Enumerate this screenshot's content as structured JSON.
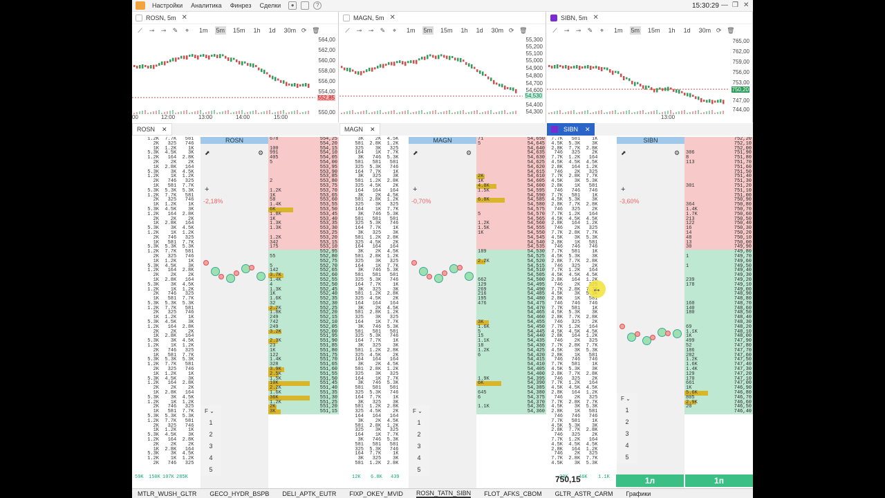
{
  "menu": {
    "items": [
      "Настройки",
      "Аналитика",
      "Финрез",
      "Сделки"
    ],
    "clock": "15:30:29"
  },
  "charts": [
    {
      "tab": "ROSN, 5m",
      "timeframes": [
        "1m",
        "5m",
        "15m",
        "1h",
        "1d",
        "30m"
      ],
      "selected": "5m",
      "prices": [
        "564,00",
        "562,00",
        "560,00",
        "558,00",
        "556,00",
        "554,00",
        "552,85",
        "550,00"
      ],
      "current_price": "552,85",
      "times": [
        "00",
        "12:00",
        "13:00",
        "14:00",
        "15:00"
      ]
    },
    {
      "tab": "MAGN, 5m",
      "timeframes": [
        "1m",
        "5m",
        "15m",
        "1h",
        "1d",
        "30m"
      ],
      "selected": "5m",
      "prices": [
        "55,300",
        "55,200",
        "55,100",
        "55,000",
        "54,900",
        "54,800",
        "54,700",
        "54,600",
        "54,530",
        "54,400",
        "54,300"
      ],
      "current_price": "54,530",
      "times": []
    },
    {
      "tab": "SIBN, 5m",
      "timeframes": [
        "1m",
        "5m",
        "15m",
        "1h",
        "1d",
        "30m"
      ],
      "selected": "5m",
      "prices": [
        "765,00",
        "762,00",
        "759,00",
        "756,00",
        "753,00",
        "750,20",
        "747,00",
        "744,00"
      ],
      "current_price": "750,20",
      "times": [
        "13:00"
      ]
    }
  ],
  "doms": [
    {
      "tab": "ROSN",
      "header": "ROSN",
      "pct": "-2,18%",
      "book": [
        [
          "678",
          "554,25"
        ],
        [
          "",
          "554,20"
        ],
        [
          "100",
          "554,15"
        ],
        [
          "991",
          "554,10"
        ],
        [
          "405",
          "554,05"
        ],
        [
          "5",
          "554,00"
        ],
        [
          "",
          "553,95"
        ],
        [
          "",
          "553,90"
        ],
        [
          "",
          "553,85"
        ],
        [
          "2",
          "553,80"
        ],
        [
          "",
          "553,75"
        ],
        [
          "1.2K",
          "553,70"
        ],
        [
          "1K",
          "553,65"
        ],
        [
          "58",
          "553,60"
        ],
        [
          "1.4K",
          "553,55"
        ],
        [
          "6K",
          "553,50"
        ],
        [
          "1.8K",
          "553,45"
        ],
        [
          "1K",
          "553,40"
        ],
        [
          "1.3K",
          "553,35"
        ],
        [
          "1.3K",
          "553,30"
        ],
        [
          "",
          "553,25"
        ],
        [
          "1.2K",
          "553,20"
        ],
        [
          "342",
          "553,15"
        ],
        [
          "175",
          "553,10"
        ],
        [
          "",
          "552,95"
        ],
        [
          "55",
          "552,80"
        ],
        [
          "",
          "552,75"
        ],
        [
          "5",
          "552,70"
        ],
        [
          "142",
          "552,65"
        ],
        [
          "3.7K",
          "552,60"
        ],
        [
          "1.4K",
          "552,55"
        ],
        [
          "4",
          "552,50"
        ],
        [
          "1.3K",
          "552,45"
        ],
        [
          "1K",
          "552,40"
        ],
        [
          "1.6K",
          "552,35"
        ],
        [
          "32",
          "552,30"
        ],
        [
          "2.2K",
          "552,25"
        ],
        [
          "1.8K",
          "552,20"
        ],
        [
          "249",
          "552,15"
        ],
        [
          "742",
          "552,10"
        ],
        [
          "249",
          "552,05"
        ],
        [
          "3.2K",
          "552,00"
        ],
        [
          "",
          "551,95"
        ],
        [
          "2.3K",
          "551,90"
        ],
        [
          "23",
          "551,85"
        ],
        [
          "1K",
          "551,80"
        ],
        [
          "122",
          "551,75"
        ],
        [
          "1.4K",
          "551,70"
        ],
        [
          "328",
          "551,65"
        ],
        [
          "3.9K",
          "551,60"
        ],
        [
          "2.5K",
          "551,55"
        ],
        [
          "1.5K",
          "551,50"
        ],
        [
          "10K",
          "551,45"
        ],
        [
          "2.2K",
          "551,40"
        ],
        [
          "1.6K",
          "551,35"
        ],
        [
          "36K",
          "551,30"
        ],
        [
          "1.2K",
          "551,25"
        ],
        [
          "2K",
          "551,20"
        ],
        [
          "3K",
          "551,15"
        ]
      ],
      "levels": [
        "1",
        "2",
        "3",
        "4",
        "5"
      ],
      "stats": [
        "59K",
        "150K",
        "107K",
        "285K"
      ]
    },
    {
      "tab": "MAGN",
      "header": "MAGN",
      "pct": "-0,70%",
      "book": [
        [
          "71",
          "54,650"
        ],
        [
          "5",
          "54,645"
        ],
        [
          "",
          "54,640"
        ],
        [
          "",
          "54,635"
        ],
        [
          "",
          "54,630"
        ],
        [
          "",
          "54,625"
        ],
        [
          "",
          "54,620"
        ],
        [
          "",
          "54,615"
        ],
        [
          "2K",
          "54,610"
        ],
        [
          "1K",
          "54,605"
        ],
        [
          "4.8K",
          "54,600"
        ],
        [
          "1.5K",
          "54,595"
        ],
        [
          "",
          "54,590"
        ],
        [
          "6.8K",
          "54,585"
        ],
        [
          "",
          "54,580"
        ],
        [
          "",
          "54,575"
        ],
        [
          "5",
          "54,570"
        ],
        [
          "",
          "54,565"
        ],
        [
          "1.2K",
          "54,560"
        ],
        [
          "1.5K",
          "54,555"
        ],
        [
          "1K",
          "54,550"
        ],
        [
          "",
          "54,545"
        ],
        [
          "",
          "54,540"
        ],
        [
          "",
          "54,535"
        ],
        [
          "189",
          "54,530"
        ],
        [
          "",
          "54,525"
        ],
        [
          "2.2K",
          "54,520"
        ],
        [
          "",
          "54,515"
        ],
        [
          "",
          "54,510"
        ],
        [
          "",
          "54,505"
        ],
        [
          "662",
          "54,500"
        ],
        [
          "129",
          "54,495"
        ],
        [
          "269",
          "54,490"
        ],
        [
          "216",
          "54,485"
        ],
        [
          "195",
          "54,480"
        ],
        [
          "476",
          "54,475"
        ],
        [
          "",
          "54,470"
        ],
        [
          "",
          "54,465"
        ],
        [
          "",
          "54,460"
        ],
        [
          "3K",
          "54,455"
        ],
        [
          "1.6K",
          "54,450"
        ],
        [
          "5",
          "54,445"
        ],
        [
          "15",
          "54,440"
        ],
        [
          "1.1K",
          "54,435"
        ],
        [
          "18",
          "54,430"
        ],
        [
          "1.2K",
          "54,425"
        ],
        [
          "6",
          "54,420"
        ],
        [
          "",
          "54,415"
        ],
        [
          "",
          "54,410"
        ],
        [
          "",
          "54,405"
        ],
        [
          "",
          "54,400"
        ],
        [
          "1.9K",
          "54,395"
        ],
        [
          "6K",
          "54,390"
        ],
        [
          "",
          "54,385"
        ],
        [
          "645",
          "54,380"
        ],
        [
          "6",
          "54,375"
        ],
        [
          "",
          "54,370"
        ],
        [
          "1.1K",
          "54,365"
        ],
        [
          "",
          "54,360"
        ]
      ],
      "levels": [
        "1",
        "2",
        "3",
        "4",
        "5"
      ],
      "stats": [
        "12K",
        "6.8K",
        "439",
        ""
      ]
    },
    {
      "tab": "SIBN",
      "header": "SIBN",
      "pct": "-3,60%",
      "book": [
        [
          "",
          "752,20"
        ],
        [
          "",
          "752,10"
        ],
        [
          "",
          "752,00"
        ],
        [
          "306",
          "751,90"
        ],
        [
          "8",
          "751,80"
        ],
        [
          "113",
          "751,70"
        ],
        [
          "",
          "751,60"
        ],
        [
          "",
          "751,50"
        ],
        [
          "",
          "751,40"
        ],
        [
          "",
          "751,30"
        ],
        [
          "301",
          "751,20"
        ],
        [
          "",
          "751,10"
        ],
        [
          "",
          "751,00"
        ],
        [
          "",
          "750,90"
        ],
        [
          "364",
          "750,80"
        ],
        [
          "1.4K",
          "750,70"
        ],
        [
          "1.7K",
          "750,60"
        ],
        [
          "213",
          "750,50"
        ],
        [
          "122",
          "750,40"
        ],
        [
          "16",
          "750,30"
        ],
        [
          "14",
          "750,20"
        ],
        [
          "48",
          "750,10"
        ],
        [
          "13",
          "750,00"
        ],
        [
          "30",
          "749,90"
        ],
        [
          "",
          "749,80"
        ],
        [
          "1",
          "749,70"
        ],
        [
          "",
          "749,60"
        ],
        [
          "1",
          "749,50"
        ],
        [
          "",
          "749,40"
        ],
        [
          "",
          "749,30"
        ],
        [
          "239",
          "749,20"
        ],
        [
          "178",
          "749,10"
        ],
        [
          "",
          "749,00"
        ],
        [
          "",
          "748,90"
        ],
        [
          "",
          "748,80"
        ],
        [
          "160",
          "748,70"
        ],
        [
          "140",
          "748,60"
        ],
        [
          "180",
          "748,50"
        ],
        [
          "",
          "748,40"
        ],
        [
          "",
          "748,30"
        ],
        [
          "69",
          "748,20"
        ],
        [
          "1.1K",
          "748,10"
        ],
        [
          "1K",
          "748,00"
        ],
        [
          "499",
          "747,90"
        ],
        [
          "52",
          "747,80"
        ],
        [
          "186",
          "747,70"
        ],
        [
          "282",
          "747,60"
        ],
        [
          "1.2K",
          "747,50"
        ],
        [
          "1.6K",
          "747,40"
        ],
        [
          "1.4K",
          "747,30"
        ],
        [
          "129",
          "747,20"
        ],
        [
          "170",
          "747,10"
        ],
        [
          "661",
          "747,00"
        ],
        [
          "1K",
          "746,90"
        ],
        [
          "5.6K",
          "746,80"
        ],
        [
          "805",
          "746,70"
        ],
        [
          "2.9K",
          "746,60"
        ],
        [
          "20",
          "746,50"
        ],
        [
          "",
          "746,40"
        ]
      ],
      "levels": [
        "1",
        "2",
        "3",
        "4",
        "5"
      ],
      "stats": [
        "23K",
        "46K",
        "1.1K",
        ""
      ],
      "big_price": "750,15",
      "lot_left": "1л",
      "lot_right": "1п"
    }
  ],
  "status_tabs": [
    "MTLR_WUSH_GLTR",
    "GECO_HYDR_BSPB",
    "DELI_APTK_EUTR",
    "FIXP_OKEY_MVID",
    "ROSN_TATN_SIBN",
    "FLOT_AFKS_CBOM",
    "GLTR_ASTR_CARM",
    "Графики"
  ],
  "active_status": "ROSN_TATN_SIBN",
  "colors": {
    "ask": "#f8c9c9",
    "bid": "#bfe8d3",
    "accent": "#2a64c8",
    "gold": "#d9b52a"
  }
}
